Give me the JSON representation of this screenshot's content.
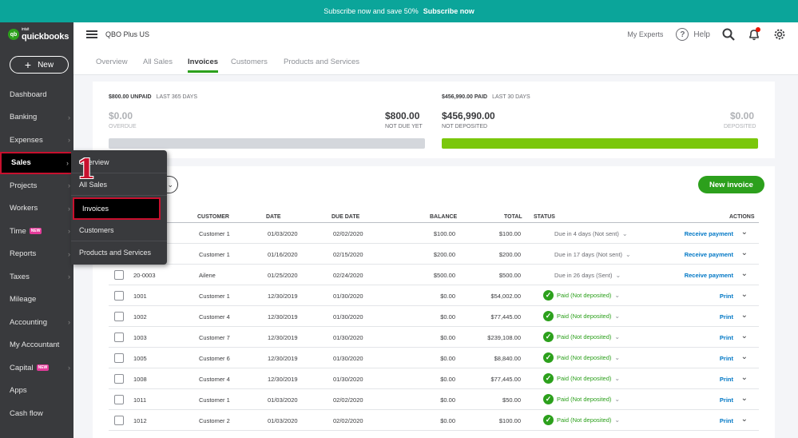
{
  "banner": {
    "text": "Subscribe now and save 50%",
    "cta": "Subscribe now"
  },
  "sidebar": {
    "logo_small": "intuit",
    "logo": "quickbooks",
    "new_button": "New",
    "new_badge": "NEW",
    "items": [
      {
        "label": "Dashboard"
      },
      {
        "label": "Banking"
      },
      {
        "label": "Expenses"
      },
      {
        "label": "Sales"
      },
      {
        "label": "Projects"
      },
      {
        "label": "Workers"
      },
      {
        "label": "Time"
      },
      {
        "label": "Reports"
      },
      {
        "label": "Taxes"
      },
      {
        "label": "Mileage"
      },
      {
        "label": "Accounting"
      },
      {
        "label": "My Accountant"
      },
      {
        "label": "Capital"
      },
      {
        "label": "Apps"
      },
      {
        "label": "Cash flow"
      }
    ]
  },
  "flyout": {
    "items": [
      {
        "label": "Overview"
      },
      {
        "label": "All Sales"
      },
      {
        "label": "Invoices"
      },
      {
        "label": "Customers"
      },
      {
        "label": "Products and Services"
      }
    ],
    "step_number": "1"
  },
  "header": {
    "company": "QBO Plus US",
    "my_experts": "My Experts",
    "help": "Help"
  },
  "tabs": [
    "Overview",
    "All Sales",
    "Invoices",
    "Customers",
    "Products and Services"
  ],
  "summary": {
    "unpaid_amount": "$800.00 UNPAID",
    "unpaid_period": "LAST 365 DAYS",
    "overdue_amount": "$0.00",
    "overdue_label": "OVERDUE",
    "not_due_amount": "$800.00",
    "not_due_label": "NOT DUE YET",
    "paid_amount": "$456,990.00 PAID",
    "paid_period": "LAST 30 DAYS",
    "not_deposited_amount": "$456,990.00",
    "not_deposited_label": "NOT DEPOSITED",
    "deposited_amount": "$0.00",
    "deposited_label": "DEPOSITED",
    "unpaid_bar_fill": 0,
    "paid_bar_fill": 1.0
  },
  "table": {
    "new_invoice": "New invoice",
    "headers": {
      "customer": "CUSTOMER",
      "date": "DATE",
      "due_date": "DUE DATE",
      "balance": "BALANCE",
      "total": "TOTAL",
      "status": "STATUS",
      "actions": "ACTIONS"
    },
    "rows": [
      {
        "no": "",
        "customer": "Customer 1",
        "date": "01/03/2020",
        "due": "02/02/2020",
        "balance": "$100.00",
        "total": "$100.00",
        "status": "Due in 4 days (Not sent)",
        "paid": false,
        "action": "Receive payment"
      },
      {
        "no": "",
        "customer": "Customer 1",
        "date": "01/16/2020",
        "due": "02/15/2020",
        "balance": "$200.00",
        "total": "$200.00",
        "status": "Due in 17 days (Not sent)",
        "paid": false,
        "action": "Receive payment"
      },
      {
        "no": "20-0003",
        "customer": "Ailene",
        "date": "01/25/2020",
        "due": "02/24/2020",
        "balance": "$500.00",
        "total": "$500.00",
        "status": "Due in 26 days (Sent)",
        "paid": false,
        "action": "Receive payment"
      },
      {
        "no": "1001",
        "customer": "Customer 1",
        "date": "12/30/2019",
        "due": "01/30/2020",
        "balance": "$0.00",
        "total": "$54,002.00",
        "status": "Paid (Not deposited)",
        "paid": true,
        "action": "Print"
      },
      {
        "no": "1002",
        "customer": "Customer 4",
        "date": "12/30/2019",
        "due": "01/30/2020",
        "balance": "$0.00",
        "total": "$77,445.00",
        "status": "Paid (Not deposited)",
        "paid": true,
        "action": "Print"
      },
      {
        "no": "1003",
        "customer": "Customer 7",
        "date": "12/30/2019",
        "due": "01/30/2020",
        "balance": "$0.00",
        "total": "$239,108.00",
        "status": "Paid (Not deposited)",
        "paid": true,
        "action": "Print"
      },
      {
        "no": "1005",
        "customer": "Customer 6",
        "date": "12/30/2019",
        "due": "01/30/2020",
        "balance": "$0.00",
        "total": "$8,840.00",
        "status": "Paid (Not deposited)",
        "paid": true,
        "action": "Print"
      },
      {
        "no": "1008",
        "customer": "Customer 4",
        "date": "12/30/2019",
        "due": "01/30/2020",
        "balance": "$0.00",
        "total": "$77,445.00",
        "status": "Paid (Not deposited)",
        "paid": true,
        "action": "Print"
      },
      {
        "no": "1011",
        "customer": "Customer 1",
        "date": "01/03/2020",
        "due": "02/02/2020",
        "balance": "$0.00",
        "total": "$50.00",
        "status": "Paid (Not deposited)",
        "paid": true,
        "action": "Print"
      },
      {
        "no": "1012",
        "customer": "Customer 2",
        "date": "01/03/2020",
        "due": "02/02/2020",
        "balance": "$0.00",
        "total": "$100.00",
        "status": "Paid (Not deposited)",
        "paid": true,
        "action": "Print"
      }
    ]
  },
  "colors": {
    "brand_green": "#2ca01c",
    "banner": "#0ba59a",
    "sidebar": "#393a3d",
    "highlight": "#c8102e",
    "link": "#0077c5"
  },
  "icons": [
    "hamburger-icon",
    "help-icon",
    "search-icon",
    "bell-icon",
    "gear-icon",
    "check-icon",
    "chevron-down-icon",
    "chevron-right-icon",
    "plus-icon"
  ]
}
